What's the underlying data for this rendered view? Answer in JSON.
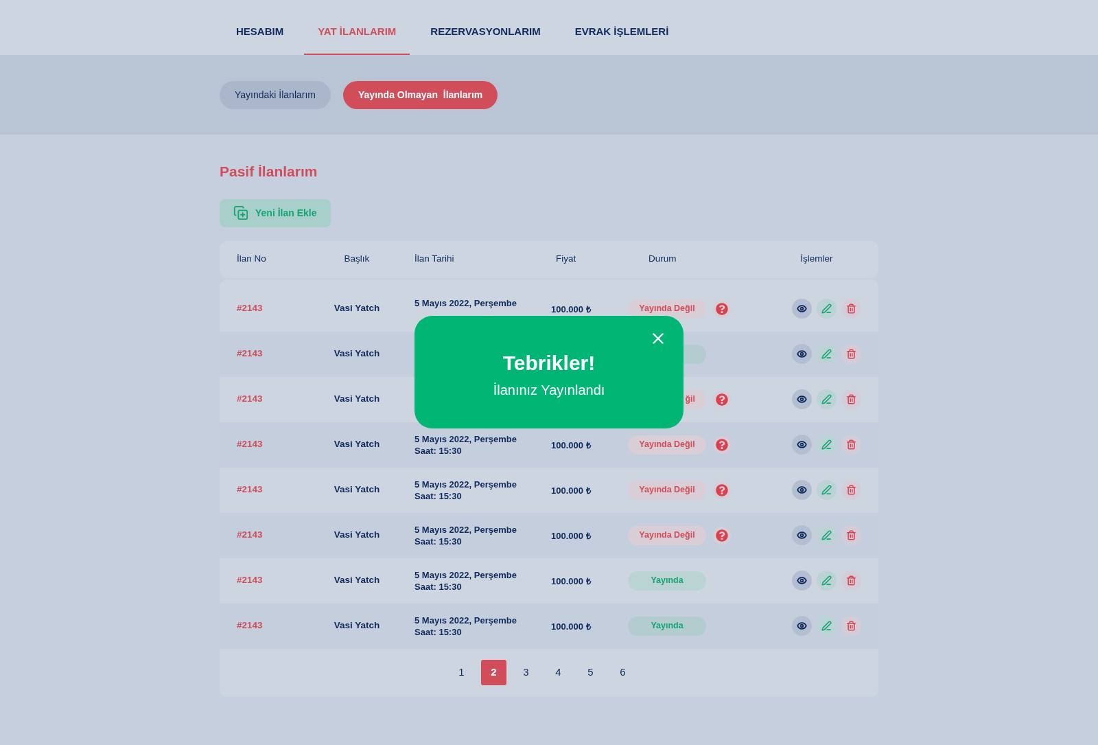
{
  "tabs": [
    {
      "label": "HESABIM",
      "selected": false
    },
    {
      "label": "YAT İLANLARIM",
      "selected": true
    },
    {
      "label": "REZERVASYONLARIM",
      "selected": false
    },
    {
      "label": "EVRAK İŞLEMLERİ",
      "selected": false
    }
  ],
  "subtabs": [
    {
      "label": "Yayındaki İlanlarım",
      "selected": false
    },
    {
      "label": "Yayında Olmayan  İlanlarım",
      "selected": true
    }
  ],
  "title": "Pasif İlanlarım",
  "add_button": "Yeni İlan Ekle",
  "table": {
    "columns": [
      "İlan No",
      "Başlık",
      "İlan Tarihi",
      "Fiyat",
      "Durum",
      "İşlemler"
    ],
    "rows": [
      {
        "no": "#2143",
        "title": "Vasi Yatch",
        "date": "5 Mayıs 2022, Perşembe",
        "price": "100.000 ₺",
        "status": {
          "kind": "unpublished",
          "label": "Yayında Değil"
        }
      },
      {
        "no": "#2143",
        "title": "Vasi Yatch",
        "status": {
          "kind": "published"
        }
      },
      {
        "no": "#2143",
        "title": "Vasi Yatch",
        "status": {
          "kind": "unpublished",
          "label": "ğil"
        }
      },
      {
        "no": "#2143",
        "title": "Vasi Yatch",
        "date": "5 Mayıs 2022, Perşembe",
        "time": "Saat: 15:30",
        "price": "100.000 ₺",
        "status": {
          "kind": "unpublished",
          "label": "Yayında Değil"
        }
      },
      {
        "no": "#2143",
        "title": "Vasi Yatch",
        "date": "5 Mayıs 2022, Perşembe",
        "time": "Saat: 15:30",
        "price": "100.000 ₺",
        "status": {
          "kind": "unpublished",
          "label": "Yayında Değil"
        }
      },
      {
        "no": "#2143",
        "title": "Vasi Yatch",
        "date": "5 Mayıs 2022, Perşembe",
        "time": "Saat: 15:30",
        "price": "100.000 ₺",
        "status": {
          "kind": "unpublished",
          "label": "Yayında Değil"
        }
      },
      {
        "no": "#2143",
        "title": "Vasi Yatch",
        "date": "5 Mayıs 2022, Perşembe",
        "time": "Saat: 15:30",
        "price": "100.000 ₺",
        "status": {
          "kind": "published",
          "label": "Yayında"
        }
      },
      {
        "no": "#2143",
        "title": "Vasi Yatch",
        "date": "5 Mayıs 2022, Perşembe",
        "time": "Saat: 15:30",
        "price": "100.000 ₺",
        "status": {
          "kind": "published",
          "label": "Yayında"
        }
      }
    ]
  },
  "pagination": [
    {
      "label": "1",
      "selected": false
    },
    {
      "label": "2",
      "selected": true
    },
    {
      "label": "3",
      "selected": false
    },
    {
      "label": "4",
      "selected": false
    },
    {
      "label": "5",
      "selected": false
    },
    {
      "label": "6",
      "selected": false
    }
  ],
  "toast": {
    "title": "Tebrikler!",
    "message": "İlanınız Yayınlandı"
  }
}
